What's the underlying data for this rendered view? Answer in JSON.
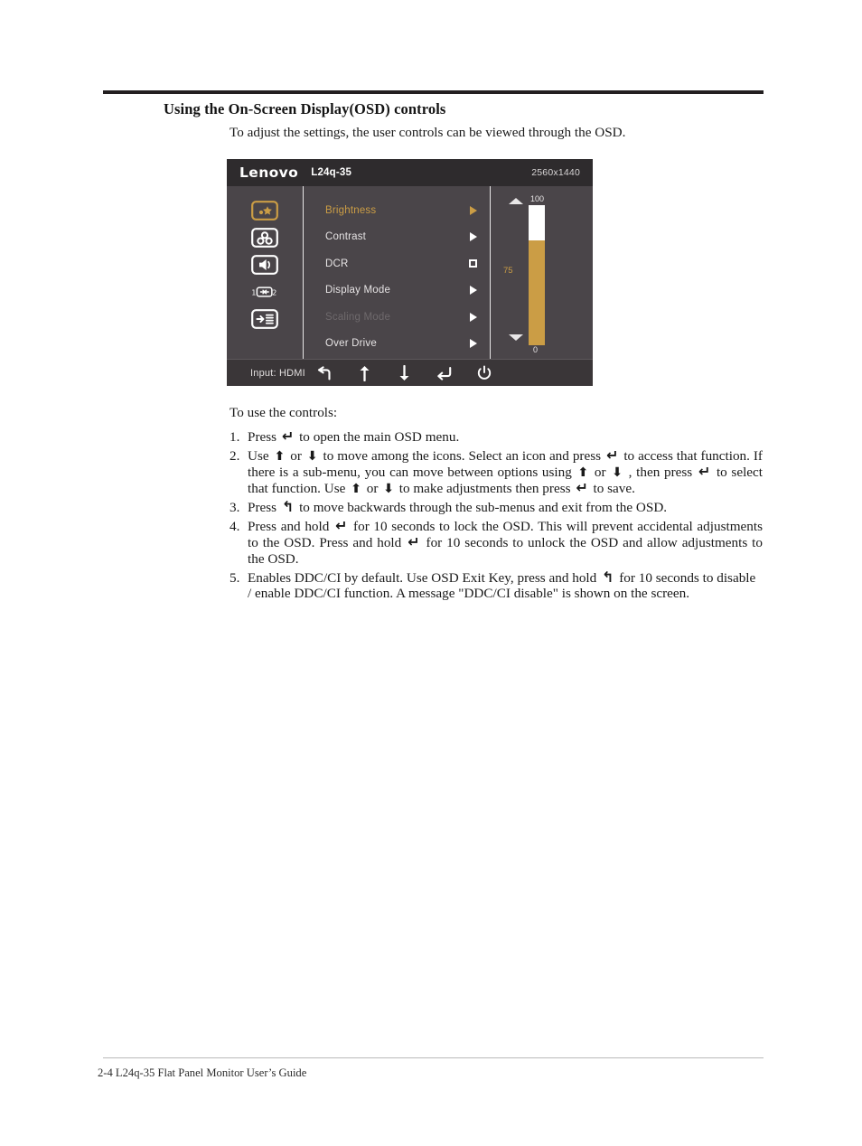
{
  "document": {
    "section_title": "Using the On-Screen Display(OSD) controls",
    "intro": "To adjust the settings, the user controls can be viewed through the OSD.",
    "use_controls_heading": "To use the controls:",
    "footer": "2-4  L24q-35 Flat Panel Monitor User’s Guide"
  },
  "osd": {
    "brand": "Lenovo",
    "model": "L24q-35",
    "resolution": "2560x1440",
    "rail_icons": [
      {
        "name": "brightness-contrast-icon",
        "selected": true
      },
      {
        "name": "color-settings-icon",
        "selected": false
      },
      {
        "name": "audio-speaker-icon",
        "selected": false
      },
      {
        "name": "input-source-switch-icon",
        "selected": false
      },
      {
        "name": "osd-menu-settings-icon",
        "selected": false
      }
    ],
    "menu_items": [
      {
        "label": "Brightness",
        "marker": "arrow",
        "state": "selected"
      },
      {
        "label": "Contrast",
        "marker": "arrow",
        "state": "normal"
      },
      {
        "label": "DCR",
        "marker": "checkbox",
        "state": "normal"
      },
      {
        "label": "Display Mode",
        "marker": "arrow",
        "state": "normal"
      },
      {
        "label": "Scaling Mode",
        "marker": "arrow",
        "state": "disabled"
      },
      {
        "label": "Over Drive",
        "marker": "arrow",
        "state": "normal"
      }
    ],
    "slider": {
      "max_label": "100",
      "min_label": "0",
      "value_label": "75",
      "value": 75,
      "max": 100,
      "min": 0,
      "up_caret": "caret-up-icon",
      "down_caret": "caret-down-icon"
    },
    "footer_bar": {
      "input_label": "Input: HDMI",
      "buttons": [
        {
          "name": "back-button",
          "glyph": "back"
        },
        {
          "name": "up-button",
          "glyph": "up"
        },
        {
          "name": "down-button",
          "glyph": "down"
        },
        {
          "name": "enter-button",
          "glyph": "enter"
        },
        {
          "name": "power-button",
          "glyph": "power"
        }
      ]
    },
    "colors": {
      "accent": "#cb9d45",
      "panel_bg": "#4a4549",
      "header_bg": "#2e2b2d",
      "footer_bg": "#3a3638",
      "text": "#e6e3e4",
      "disabled_text": "#6e696c"
    }
  },
  "steps": [
    {
      "num": "1.",
      "parts": [
        {
          "t": "text",
          "v": "Press "
        },
        {
          "t": "glyph",
          "v": "enter"
        },
        {
          "t": "text",
          "v": " to open the main OSD menu."
        }
      ]
    },
    {
      "num": "2.",
      "parts": [
        {
          "t": "text",
          "v": "Use "
        },
        {
          "t": "glyph",
          "v": "up"
        },
        {
          "t": "text",
          "v": " or "
        },
        {
          "t": "glyph",
          "v": "down"
        },
        {
          "t": "text",
          "v": " to move among the icons. Select an icon and press  "
        },
        {
          "t": "glyph",
          "v": "enter"
        },
        {
          "t": "text",
          "v": " to access that function. If there is a sub-menu, you can move between options using "
        },
        {
          "t": "glyph",
          "v": "up"
        },
        {
          "t": "text",
          "v": " or "
        },
        {
          "t": "glyph",
          "v": "down"
        },
        {
          "t": "text",
          "v": " ,  then press "
        },
        {
          "t": "glyph",
          "v": "enter"
        },
        {
          "t": "text",
          "v": " to select that function. Use "
        },
        {
          "t": "glyph",
          "v": "up"
        },
        {
          "t": "text",
          "v": " or "
        },
        {
          "t": "glyph",
          "v": "down"
        },
        {
          "t": "text",
          "v": " to make adjustments then press "
        },
        {
          "t": "glyph",
          "v": "enter"
        },
        {
          "t": "text",
          "v": " to save."
        }
      ]
    },
    {
      "num": "3.",
      "parts": [
        {
          "t": "text",
          "v": "Press "
        },
        {
          "t": "glyph",
          "v": "back"
        },
        {
          "t": "text",
          "v": " to move backwards through the sub-menus and exit from the OSD."
        }
      ]
    },
    {
      "num": "4.",
      "parts": [
        {
          "t": "text",
          "v": "Press and hold "
        },
        {
          "t": "glyph",
          "v": "enter"
        },
        {
          "t": "text",
          "v": " for 10 seconds to lock the OSD. This will prevent accidental adjustments to the OSD. Press and hold "
        },
        {
          "t": "glyph",
          "v": "enter"
        },
        {
          "t": "text",
          "v": " for 10 seconds to unlock the OSD and allow adjustments to the OSD."
        }
      ]
    },
    {
      "num": "5.",
      "parts": [
        {
          "t": "text",
          "v": "Enables DDC/CI by default. Use OSD Exit Key, press and hold "
        },
        {
          "t": "glyph",
          "v": "back"
        },
        {
          "t": "text",
          "v": " for 10 seconds to disable / enable DDC/CI function. A message \"DDC/CI disable\" is shown on the screen."
        }
      ]
    }
  ]
}
